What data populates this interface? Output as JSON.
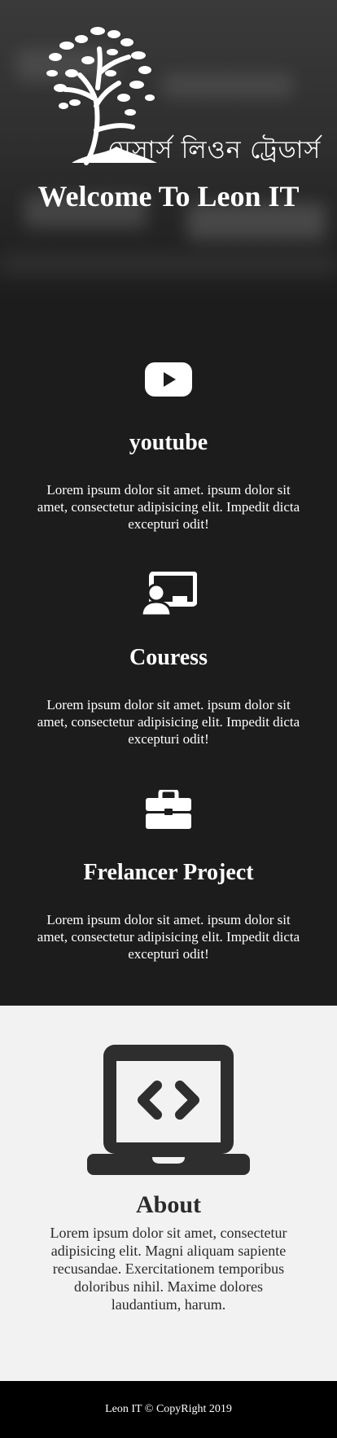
{
  "hero": {
    "logo_text": "মেসার্স লিওন ট্রেডার্স",
    "title": "Welcome To Leon IT"
  },
  "services": [
    {
      "icon": "youtube-icon",
      "title": "youtube",
      "text": "Lorem ipsum dolor sit amet. ipsum dolor sit amet, consectetur adipisicing elit. Impedit dicta excepturi odit!"
    },
    {
      "icon": "chalkboard-teacher-icon",
      "title": "Couress",
      "text": "Lorem ipsum dolor sit amet. ipsum dolor sit amet, consectetur adipisicing elit. Impedit dicta excepturi odit!"
    },
    {
      "icon": "briefcase-icon",
      "title": "Frelancer Project",
      "text": "Lorem ipsum dolor sit amet. ipsum dolor sit amet, consectetur adipisicing elit. Impedit dicta excepturi odit!"
    }
  ],
  "about": {
    "icon": "laptop-code-icon",
    "title": "About",
    "text": "Lorem ipsum dolor sit amet, consectetur adipisicing elit. Magni aliquam sapiente recusandae. Exercitationem temporibus doloribus nihil. Maxime dolores laudantium, harum."
  },
  "footer": {
    "text": "Leon IT © CopyRight 2019"
  },
  "colors": {
    "dark_bg": "#1c1c1c",
    "light_bg": "#f2f2f2",
    "footer_bg": "#000000",
    "icon_dark": "#2e2e2e"
  }
}
